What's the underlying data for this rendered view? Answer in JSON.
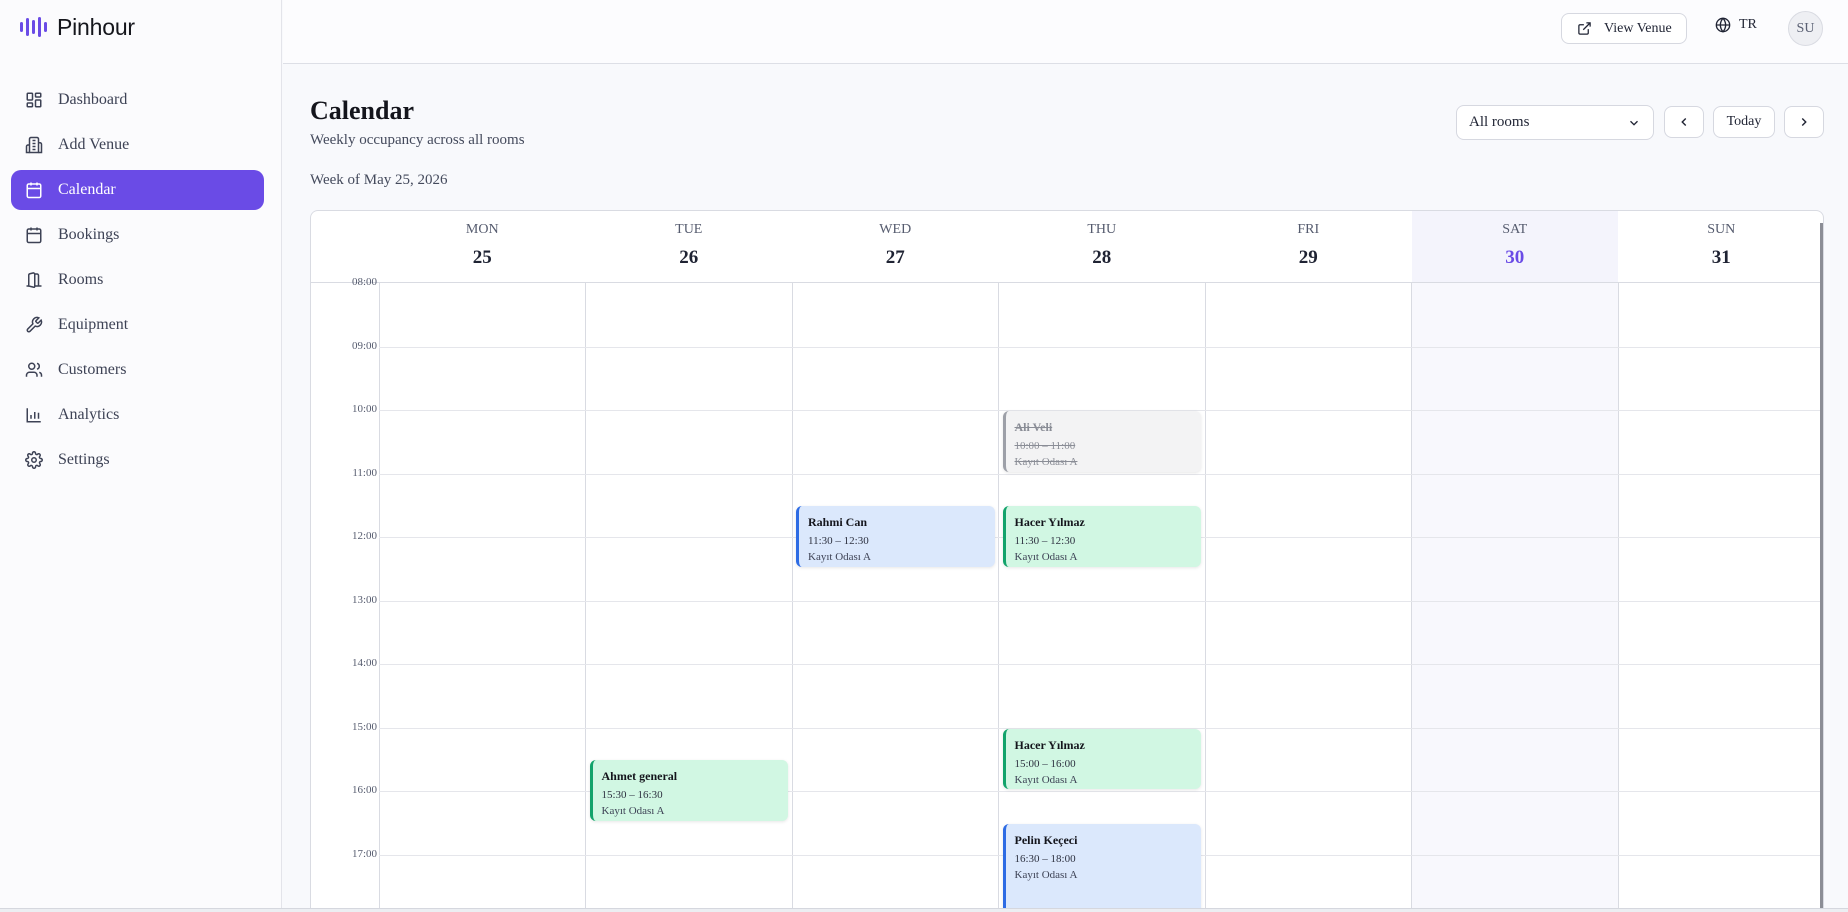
{
  "app": {
    "name": "Pinhour",
    "brand_color": "#6a4be6"
  },
  "sidebar": {
    "items": [
      {
        "label": "Dashboard",
        "icon": "dashboard-icon",
        "active": false
      },
      {
        "label": "Add Venue",
        "icon": "building-icon",
        "active": false
      },
      {
        "label": "Calendar",
        "icon": "calendar-icon",
        "active": true
      },
      {
        "label": "Bookings",
        "icon": "bookings-icon",
        "active": false
      },
      {
        "label": "Rooms",
        "icon": "door-icon",
        "active": false
      },
      {
        "label": "Equipment",
        "icon": "wrench-icon",
        "active": false
      },
      {
        "label": "Customers",
        "icon": "users-icon",
        "active": false
      },
      {
        "label": "Analytics",
        "icon": "bar-chart-icon",
        "active": false
      },
      {
        "label": "Settings",
        "icon": "gear-icon",
        "active": false
      }
    ]
  },
  "header": {
    "view_venue_label": "View Venue",
    "language": "TR",
    "avatar_initials": "SU"
  },
  "main": {
    "title": "Calendar",
    "subtitle": "Weekly occupancy across all rooms",
    "week_label": "Week of May 25, 2026",
    "room_filter": "All rooms",
    "today_label": "Today"
  },
  "calendar": {
    "days": [
      {
        "name": "MON",
        "num": "25"
      },
      {
        "name": "TUE",
        "num": "26"
      },
      {
        "name": "WED",
        "num": "27"
      },
      {
        "name": "THU",
        "num": "28"
      },
      {
        "name": "FRI",
        "num": "29"
      },
      {
        "name": "SAT",
        "num": "30",
        "highlight": true
      },
      {
        "name": "SUN",
        "num": "31"
      }
    ],
    "hours": [
      "08:00",
      "09:00",
      "10:00",
      "11:00",
      "12:00",
      "13:00",
      "14:00",
      "15:00",
      "16:00",
      "17:00"
    ],
    "events": [
      {
        "day": 3,
        "start": 10.0,
        "end": 11.0,
        "name": "Ali Veli",
        "time": "10:00 – 11:00",
        "room": "Kayıt Odası A",
        "status": "cancelled",
        "color": "#9da0a8"
      },
      {
        "day": 2,
        "start": 11.5,
        "end": 12.5,
        "name": "Rahmi Can",
        "time": "11:30 – 12:30",
        "room": "Kayıt Odası A",
        "status": "blue",
        "color": "#2d6be4"
      },
      {
        "day": 3,
        "start": 11.5,
        "end": 12.5,
        "name": "Hacer Yılmaz",
        "time": "11:30 – 12:30",
        "room": "Kayıt Odası A",
        "status": "green",
        "color": "#12a36b"
      },
      {
        "day": 3,
        "start": 15.0,
        "end": 16.0,
        "name": "Hacer Yılmaz",
        "time": "15:00 – 16:00",
        "room": "Kayıt Odası A",
        "status": "green",
        "color": "#12a36b"
      },
      {
        "day": 1,
        "start": 15.5,
        "end": 16.5,
        "name": "Ahmet general",
        "time": "15:30 – 16:30",
        "room": "Kayıt Odası A",
        "status": "green",
        "color": "#12a36b"
      },
      {
        "day": 3,
        "start": 16.5,
        "end": 18.0,
        "name": "Pelin Keçeci",
        "time": "16:30 – 18:00",
        "room": "Kayıt Odası A",
        "status": "blue",
        "color": "#2d6be4"
      }
    ]
  }
}
